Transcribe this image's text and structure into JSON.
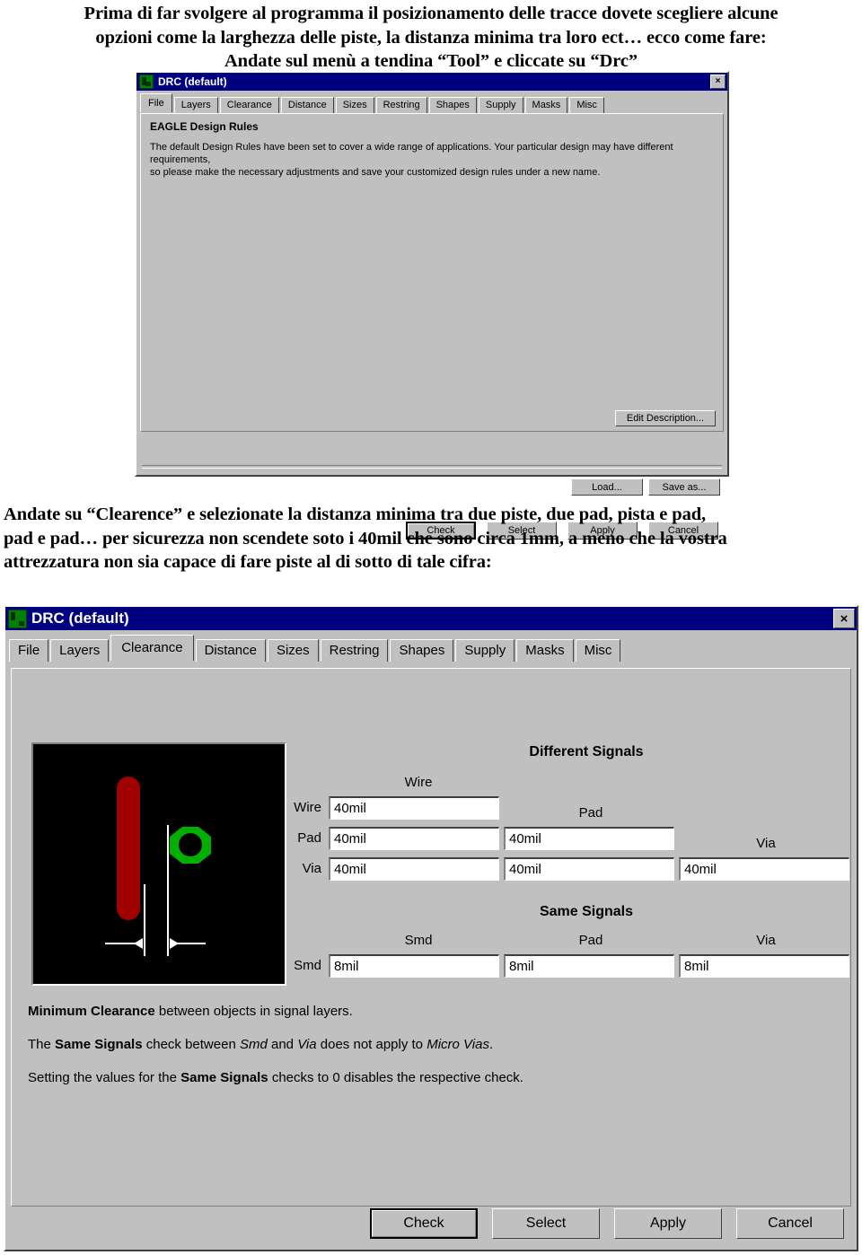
{
  "document": {
    "intro_lines": [
      "Prima di far svolgere al programma il posizionamento delle tracce dovete scegliere alcune",
      "opzioni come la larghezza delle piste, la distanza minima tra loro ect… ecco come fare:",
      "Andate sul menù a tendina “Tool” e cliccate su “Drc”"
    ],
    "middle_lines": [
      "Andate su “Clearence” e selezionate la distanza minima tra due piste, due pad, pista e pad,",
      "pad e pad… per sicurezza non scendete soto i 40mil che sono circa 1mm, a meno che la vostra",
      "attrezzatura non sia capace di fare piste al di sotto di tale cifra:"
    ]
  },
  "colors": {
    "titlebar": "#000080",
    "face": "#c0c0c0",
    "wire_red": "#a00000",
    "pad_green": "#00b000",
    "icon_green": "#008000"
  },
  "dialog1": {
    "title": "DRC (default)",
    "close_label": "×",
    "icon": "eagle-drc-icon",
    "tabs": [
      {
        "label": "File",
        "selected": true
      },
      {
        "label": "Layers",
        "selected": false
      },
      {
        "label": "Clearance",
        "selected": false
      },
      {
        "label": "Distance",
        "selected": false
      },
      {
        "label": "Sizes",
        "selected": false
      },
      {
        "label": "Restring",
        "selected": false
      },
      {
        "label": "Shapes",
        "selected": false
      },
      {
        "label": "Supply",
        "selected": false
      },
      {
        "label": "Masks",
        "selected": false
      },
      {
        "label": "Misc",
        "selected": false
      }
    ],
    "heading": "EAGLE Design Rules",
    "body_lines": [
      "The default Design Rules have been set to cover a wide range of applications. Your particular design may have different requirements,",
      "so please make the necessary adjustments and save your customized design rules under a new name."
    ],
    "edit_description_label": "Edit Description...",
    "load_label": "Load...",
    "save_as_label": "Save as...",
    "buttons": [
      {
        "label": "Check",
        "default": true
      },
      {
        "label": "Select",
        "default": false
      },
      {
        "label": "Apply",
        "default": false
      },
      {
        "label": "Cancel",
        "default": false
      }
    ]
  },
  "dialog2": {
    "title": "DRC (default)",
    "close_label": "×",
    "icon": "eagle-drc-icon",
    "tabs": [
      {
        "label": "File",
        "selected": false
      },
      {
        "label": "Layers",
        "selected": false
      },
      {
        "label": "Clearance",
        "selected": true
      },
      {
        "label": "Distance",
        "selected": false
      },
      {
        "label": "Sizes",
        "selected": false
      },
      {
        "label": "Restring",
        "selected": false
      },
      {
        "label": "Shapes",
        "selected": false
      },
      {
        "label": "Supply",
        "selected": false
      },
      {
        "label": "Masks",
        "selected": false
      },
      {
        "label": "Misc",
        "selected": false
      }
    ],
    "preview": {
      "name": "clearance-preview",
      "wire_color": "#a00000",
      "pad_color": "#00b000"
    },
    "different_signals": {
      "title": "Different Signals",
      "col_headers": [
        "Wire",
        "Pad",
        "Via"
      ],
      "row_labels": [
        "Wire",
        "Pad",
        "Via"
      ],
      "values": {
        "wire_wire": "40mil",
        "pad_wire": "40mil",
        "pad_pad": "40mil",
        "via_wire": "40mil",
        "via_pad": "40mil",
        "via_via": "40mil"
      }
    },
    "same_signals": {
      "title": "Same Signals",
      "col_headers": [
        "Smd",
        "Pad",
        "Via"
      ],
      "row_labels": [
        "Smd"
      ],
      "values": {
        "smd_smd": "8mil",
        "smd_pad": "8mil",
        "smd_via": "8mil"
      }
    },
    "description": {
      "line1_bold": "Minimum Clearance",
      "line1_rest": " between objects in signal layers.",
      "line2_a": "The ",
      "line2_bold": "Same Signals",
      "line2_b": " check between ",
      "line2_i1": "Smd",
      "line2_c": " and ",
      "line2_i2": "Via",
      "line2_d": " does not apply to ",
      "line2_i3": "Micro Vias",
      "line2_e": ".",
      "line3_a": "Setting the values for the ",
      "line3_bold": "Same Signals",
      "line3_b": " checks to 0 disables the respective check."
    },
    "buttons": [
      {
        "label": "Check",
        "default": true
      },
      {
        "label": "Select",
        "default": false
      },
      {
        "label": "Apply",
        "default": false
      },
      {
        "label": "Cancel",
        "default": false
      }
    ]
  }
}
